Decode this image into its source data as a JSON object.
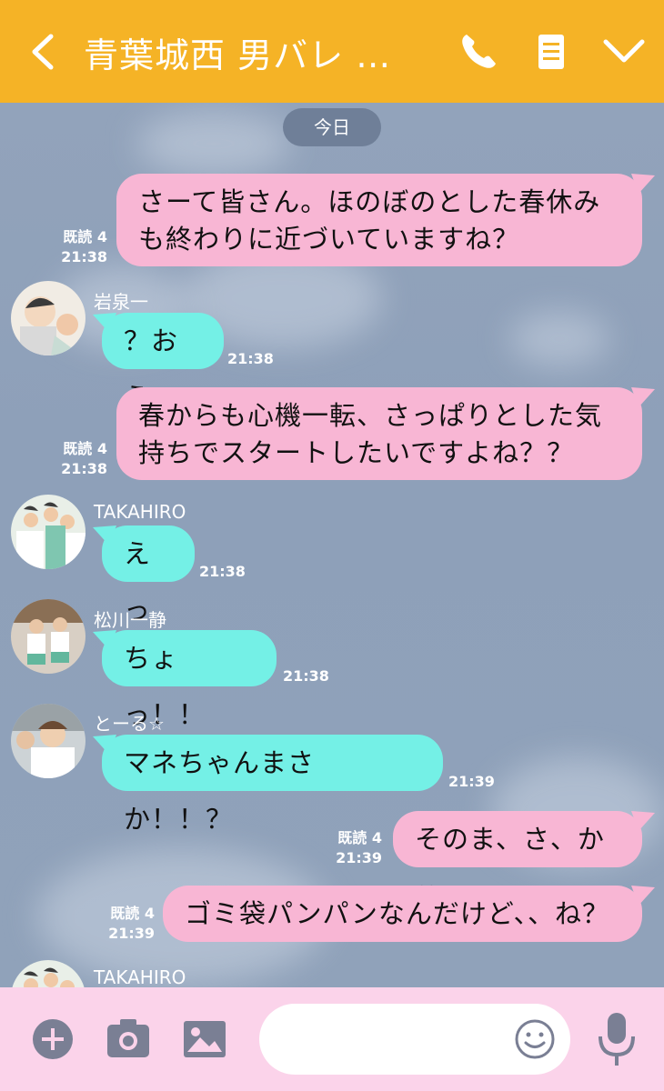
{
  "header": {
    "title": "青葉城西 男バレ …",
    "bg_color": "#f5b326",
    "icons": [
      "chevron-left-icon",
      "phone-icon",
      "memo-icon",
      "chevron-down-icon"
    ]
  },
  "chat": {
    "date_label": "今日",
    "messages": [
      {
        "side": "out",
        "text_lines": [
          "さーて皆さん。ほのぼのとした春休み",
          "も終わりに近づいていますね？"
        ],
        "read": "既読 4",
        "time": "21:38"
      },
      {
        "side": "in",
        "sender": "岩泉一",
        "text": "？おう",
        "time": "21:38"
      },
      {
        "side": "out",
        "text_lines": [
          "春からも心機一転、さっぱりとした気",
          "持ちでスタートしたいですよね？？"
        ],
        "read": "既読 4",
        "time": "21:38"
      },
      {
        "side": "in",
        "sender": "TAKAHIRO",
        "text": "えっ",
        "time": "21:38"
      },
      {
        "side": "in",
        "sender": "松川一静",
        "text": "ちょっ！！",
        "time": "21:38"
      },
      {
        "side": "in",
        "sender": "とーる☆",
        "text": "マネちゃんまさか！！？",
        "time": "21:39"
      },
      {
        "side": "out",
        "text": "そのま、さ、か♡",
        "read": "既読 4",
        "time": "21:39"
      },
      {
        "side": "out",
        "text": "ゴミ袋パンパンなんだけど、、ね？",
        "read": "既読 4",
        "time": "21:39"
      },
      {
        "side": "in",
        "sender": "TAKAHIRO"
      }
    ],
    "out_bubble_color": "#f8b6d4",
    "in_bubble_color": "#74f0e6"
  },
  "bottom_bar": {
    "icons": [
      "plus-icon",
      "camera-icon",
      "image-icon",
      "emoji-icon",
      "microphone-icon"
    ],
    "input_placeholder": "",
    "bg_color": "#fbd3ea"
  }
}
